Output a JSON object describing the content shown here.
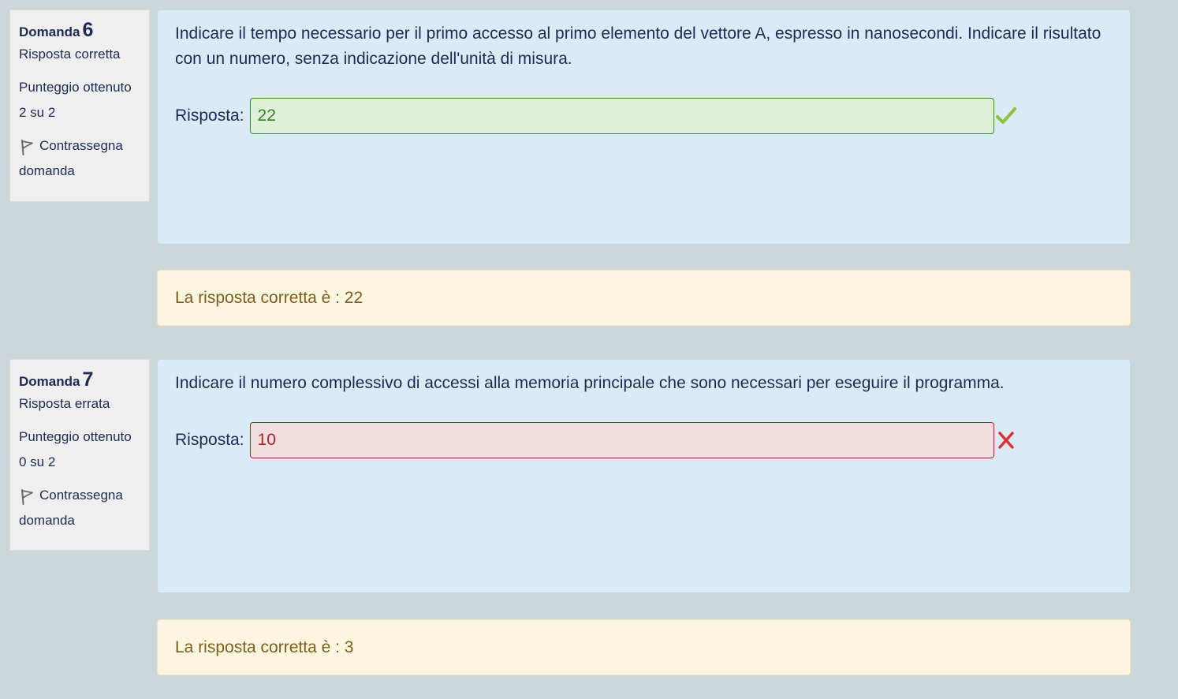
{
  "questions": [
    {
      "label": "Domanda",
      "number": "6",
      "state": "Risposta corretta",
      "grade_label": "Punteggio ottenuto",
      "grade_value": "2 su 2",
      "flag_label": "Contrassegna domanda",
      "text": "Indicare il tempo necessario per il primo accesso al primo elemento del vettore A, espresso in nanosecondi. Indicare il risultato con un numero, senza indicazione dell'unità di misura.",
      "answer_label": "Risposta:",
      "answer_value": "22",
      "result": "correct",
      "feedback": "La risposta corretta è : 22"
    },
    {
      "label": "Domanda",
      "number": "7",
      "state": "Risposta errata",
      "grade_label": "Punteggio ottenuto",
      "grade_value": "0 su 2",
      "flag_label": "Contrassegna domanda",
      "text": "Indicare il numero complessivo di accessi alla memoria principale che sono necessari per eseguire il programma.",
      "answer_label": "Risposta:",
      "answer_value": "10",
      "result": "incorrect",
      "feedback": "La risposta corretta è : 3"
    }
  ],
  "colors": {
    "correct_mark": "#8cc43c",
    "incorrect_mark": "#e03030",
    "background": "#cdd7d9",
    "formulation_bg": "#d9ebf6",
    "outcome_bg": "#fcf6e0"
  },
  "icons": {
    "flag": "flag-icon",
    "correct": "checkmark-icon",
    "incorrect": "cross-icon"
  }
}
